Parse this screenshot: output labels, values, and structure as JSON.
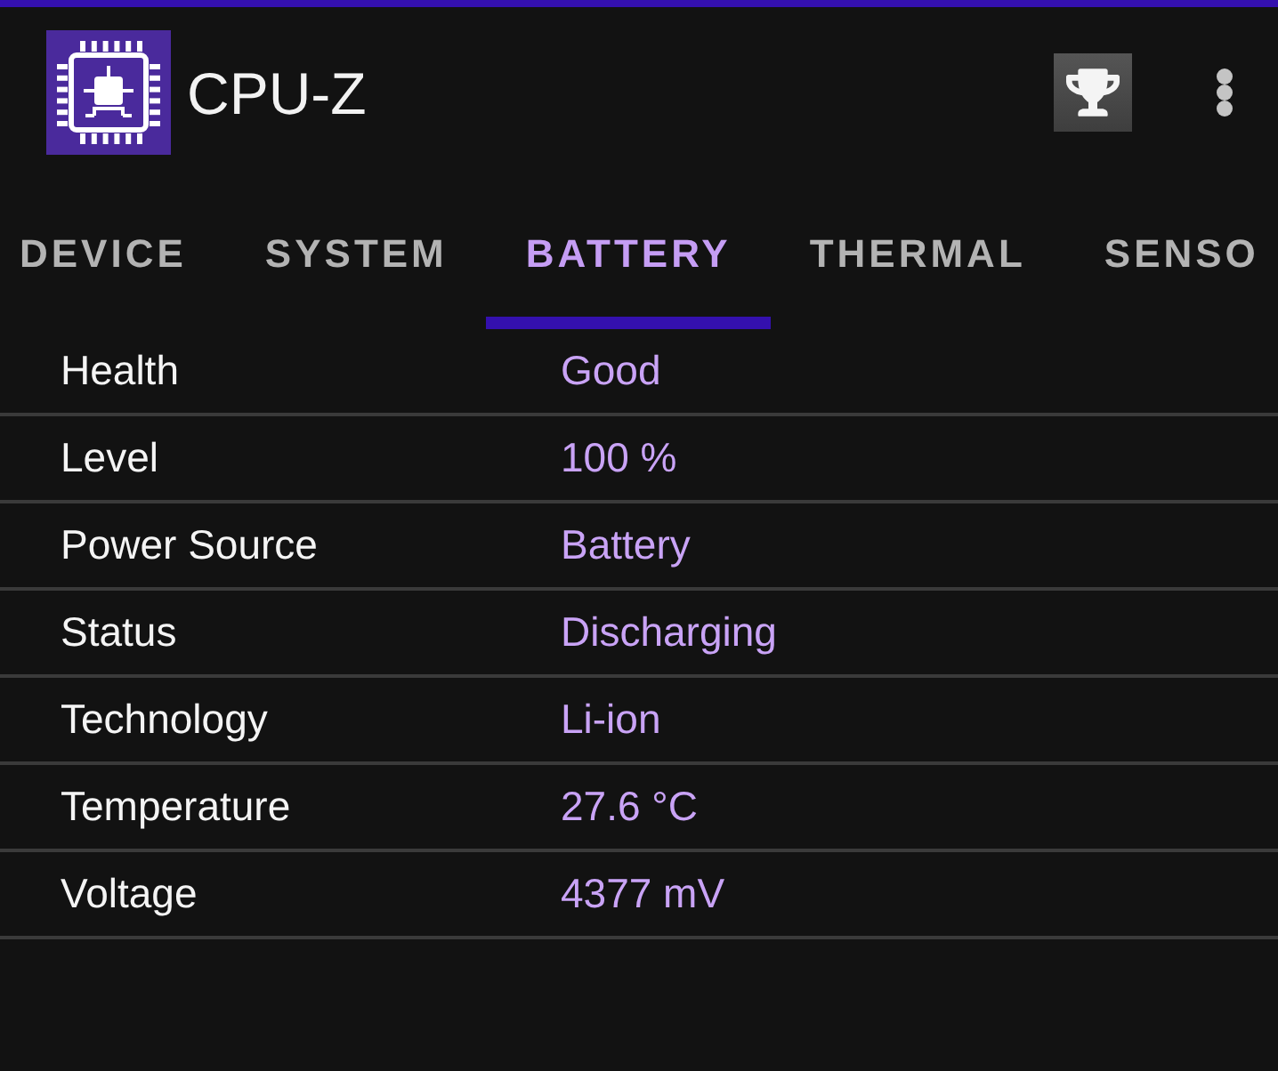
{
  "app_bar": {
    "title": "CPU-Z"
  },
  "tabs": [
    {
      "label": "DEVICE",
      "selected": false
    },
    {
      "label": "SYSTEM",
      "selected": false
    },
    {
      "label": "BATTERY",
      "selected": true
    },
    {
      "label": "THERMAL",
      "selected": false
    },
    {
      "label": "SENSO",
      "selected": false
    }
  ],
  "rows": [
    {
      "label": "Health",
      "value": "Good"
    },
    {
      "label": "Level",
      "value": "100 %"
    },
    {
      "label": "Power Source",
      "value": "Battery"
    },
    {
      "label": "Status",
      "value": "Discharging"
    },
    {
      "label": "Technology",
      "value": "Li-ion"
    },
    {
      "label": "Temperature",
      "value": "27.6 °C"
    },
    {
      "label": "Voltage",
      "value": "4377 mV"
    }
  ]
}
